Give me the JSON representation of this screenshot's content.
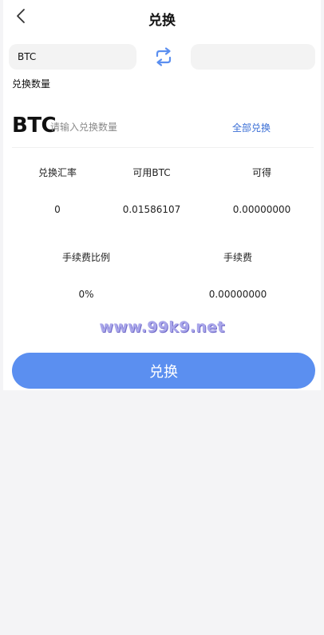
{
  "header": {
    "title": "兑换",
    "back_icon": "chevron-left-icon"
  },
  "exchange": {
    "from_coin": "BTC",
    "to_coin": "",
    "swap_icon": "swap-arrows-icon",
    "swap_color": "#5b8ff0"
  },
  "amount": {
    "label": "兑换数量",
    "coin": "BTC",
    "placeholder": "请输入兑换数量",
    "value": "",
    "all_label": "全部兑换"
  },
  "stats": {
    "rate_label": "兑换汇率",
    "rate_value": "0",
    "available_label": "可用BTC",
    "available_value": "0.01586107",
    "receive_label": "可得",
    "receive_value": "0.00000000",
    "fee_ratio_label": "手续费比例",
    "fee_ratio_value": "0%",
    "fee_label": "手续费",
    "fee_value": "0.00000000"
  },
  "watermark": {
    "text": "www.99k9.net"
  },
  "submit": {
    "label": "兑换",
    "color": "#5b8ff0"
  }
}
